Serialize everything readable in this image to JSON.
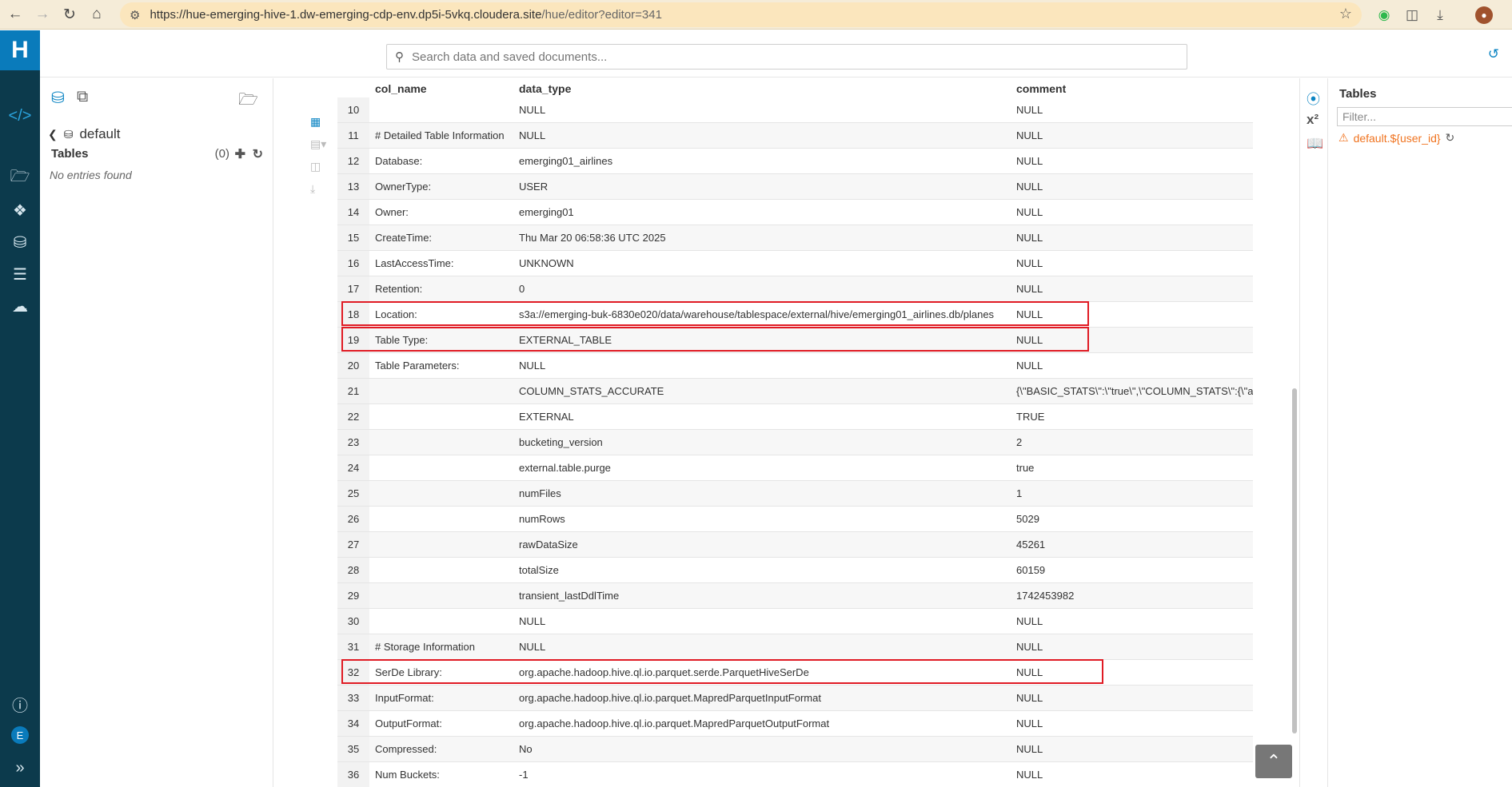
{
  "browser": {
    "url_host": "https://hue-emerging-hive-1.dw-emerging-cdp-env.dp5i-5vkq.cloudera.site",
    "url_path": "/hue/editor?editor=341"
  },
  "app": {
    "logo_text": "H",
    "user_initial": "E"
  },
  "search": {
    "placeholder": "Search data and saved documents..."
  },
  "left_panel": {
    "database": "default",
    "tables_label": "Tables",
    "tables_count": "(0)",
    "empty_text": "No entries found"
  },
  "results": {
    "columns": [
      "col_name",
      "data_type",
      "comment"
    ],
    "rows": [
      {
        "n": "10",
        "col_name": "",
        "data_type": "NULL",
        "comment": "NULL"
      },
      {
        "n": "11",
        "col_name": "# Detailed Table Information",
        "data_type": "NULL",
        "comment": "NULL"
      },
      {
        "n": "12",
        "col_name": "Database:",
        "data_type": "emerging01_airlines",
        "comment": "NULL"
      },
      {
        "n": "13",
        "col_name": "OwnerType:",
        "data_type": "USER",
        "comment": "NULL"
      },
      {
        "n": "14",
        "col_name": "Owner:",
        "data_type": "emerging01",
        "comment": "NULL"
      },
      {
        "n": "15",
        "col_name": "CreateTime:",
        "data_type": "Thu Mar 20 06:58:36 UTC 2025",
        "comment": "NULL"
      },
      {
        "n": "16",
        "col_name": "LastAccessTime:",
        "data_type": "UNKNOWN",
        "comment": "NULL"
      },
      {
        "n": "17",
        "col_name": "Retention:",
        "data_type": "0",
        "comment": "NULL"
      },
      {
        "n": "18",
        "col_name": "Location:",
        "data_type": "s3a://emerging-buk-6830e020/data/warehouse/tablespace/external/hive/emerging01_airlines.db/planes",
        "comment": "NULL"
      },
      {
        "n": "19",
        "col_name": "Table Type:",
        "data_type": "EXTERNAL_TABLE",
        "comment": "NULL"
      },
      {
        "n": "20",
        "col_name": "Table Parameters:",
        "data_type": "NULL",
        "comment": "NULL"
      },
      {
        "n": "21",
        "col_name": "",
        "data_type": "COLUMN_STATS_ACCURATE",
        "comment": "{\\\"BASIC_STATS\\\":\\\"true\\\",\\\"COLUMN_STATS\\\":{\\\"aircraft"
      },
      {
        "n": "22",
        "col_name": "",
        "data_type": "EXTERNAL",
        "comment": "TRUE"
      },
      {
        "n": "23",
        "col_name": "",
        "data_type": "bucketing_version",
        "comment": "2"
      },
      {
        "n": "24",
        "col_name": "",
        "data_type": "external.table.purge",
        "comment": "true"
      },
      {
        "n": "25",
        "col_name": "",
        "data_type": "numFiles",
        "comment": "1"
      },
      {
        "n": "26",
        "col_name": "",
        "data_type": "numRows",
        "comment": "5029"
      },
      {
        "n": "27",
        "col_name": "",
        "data_type": "rawDataSize",
        "comment": "45261"
      },
      {
        "n": "28",
        "col_name": "",
        "data_type": "totalSize",
        "comment": "60159"
      },
      {
        "n": "29",
        "col_name": "",
        "data_type": "transient_lastDdlTime",
        "comment": "1742453982"
      },
      {
        "n": "30",
        "col_name": "",
        "data_type": "NULL",
        "comment": "NULL"
      },
      {
        "n": "31",
        "col_name": "# Storage Information",
        "data_type": "NULL",
        "comment": "NULL"
      },
      {
        "n": "32",
        "col_name": "SerDe Library:",
        "data_type": "org.apache.hadoop.hive.ql.io.parquet.serde.ParquetHiveSerDe",
        "comment": "NULL"
      },
      {
        "n": "33",
        "col_name": "InputFormat:",
        "data_type": "org.apache.hadoop.hive.ql.io.parquet.MapredParquetInputFormat",
        "comment": "NULL"
      },
      {
        "n": "34",
        "col_name": "OutputFormat:",
        "data_type": "org.apache.hadoop.hive.ql.io.parquet.MapredParquetOutputFormat",
        "comment": "NULL"
      },
      {
        "n": "35",
        "col_name": "Compressed:",
        "data_type": "No",
        "comment": "NULL"
      },
      {
        "n": "36",
        "col_name": "Num Buckets:",
        "data_type": "-1",
        "comment": "NULL"
      }
    ],
    "highlighted_rows": [
      "18",
      "19",
      "32"
    ]
  },
  "assist": {
    "title": "Tables",
    "filter_placeholder": "Filter...",
    "warning_text": "default.${user_id}"
  },
  "colors": {
    "rail": "#0c3a4c",
    "accent": "#0b84c3",
    "highlight": "#e01b24",
    "warning": "#f0731f"
  }
}
